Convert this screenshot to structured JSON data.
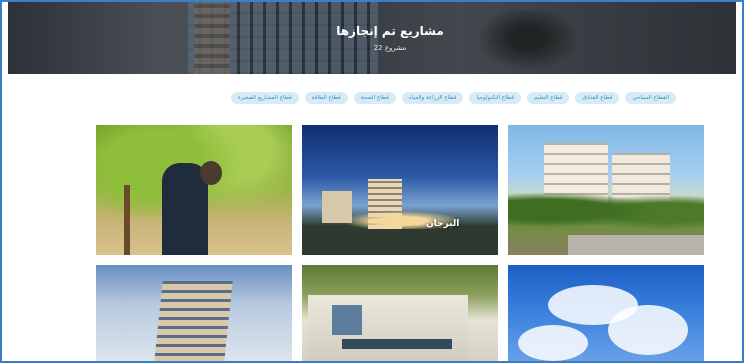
{
  "hero": {
    "title": "مشاريع تم إنجازها",
    "subtitle": "22 مشروع"
  },
  "filters": [
    "القطاع السياحي",
    "قطاع الفنادق",
    "قطاع التعليم",
    "قطاع التكنولوجيا",
    "قطاع الزراعة والمياه",
    "قطاع الصحة",
    "قطاع الطاقة",
    "قطاع المشاريع الصغيرة"
  ],
  "cards": [
    {
      "label": "",
      "sub": ""
    },
    {
      "label": "البرجان",
      "sub": ""
    },
    {
      "label": "",
      "sub": ""
    },
    {
      "label": "",
      "sub": ""
    },
    {
      "label": "",
      "sub": ""
    },
    {
      "label": "",
      "sub": ""
    }
  ],
  "colors": {
    "frame": "#3c7fc9",
    "pill_bg": "#d7ebf6",
    "pill_text": "#3a8fc0"
  }
}
